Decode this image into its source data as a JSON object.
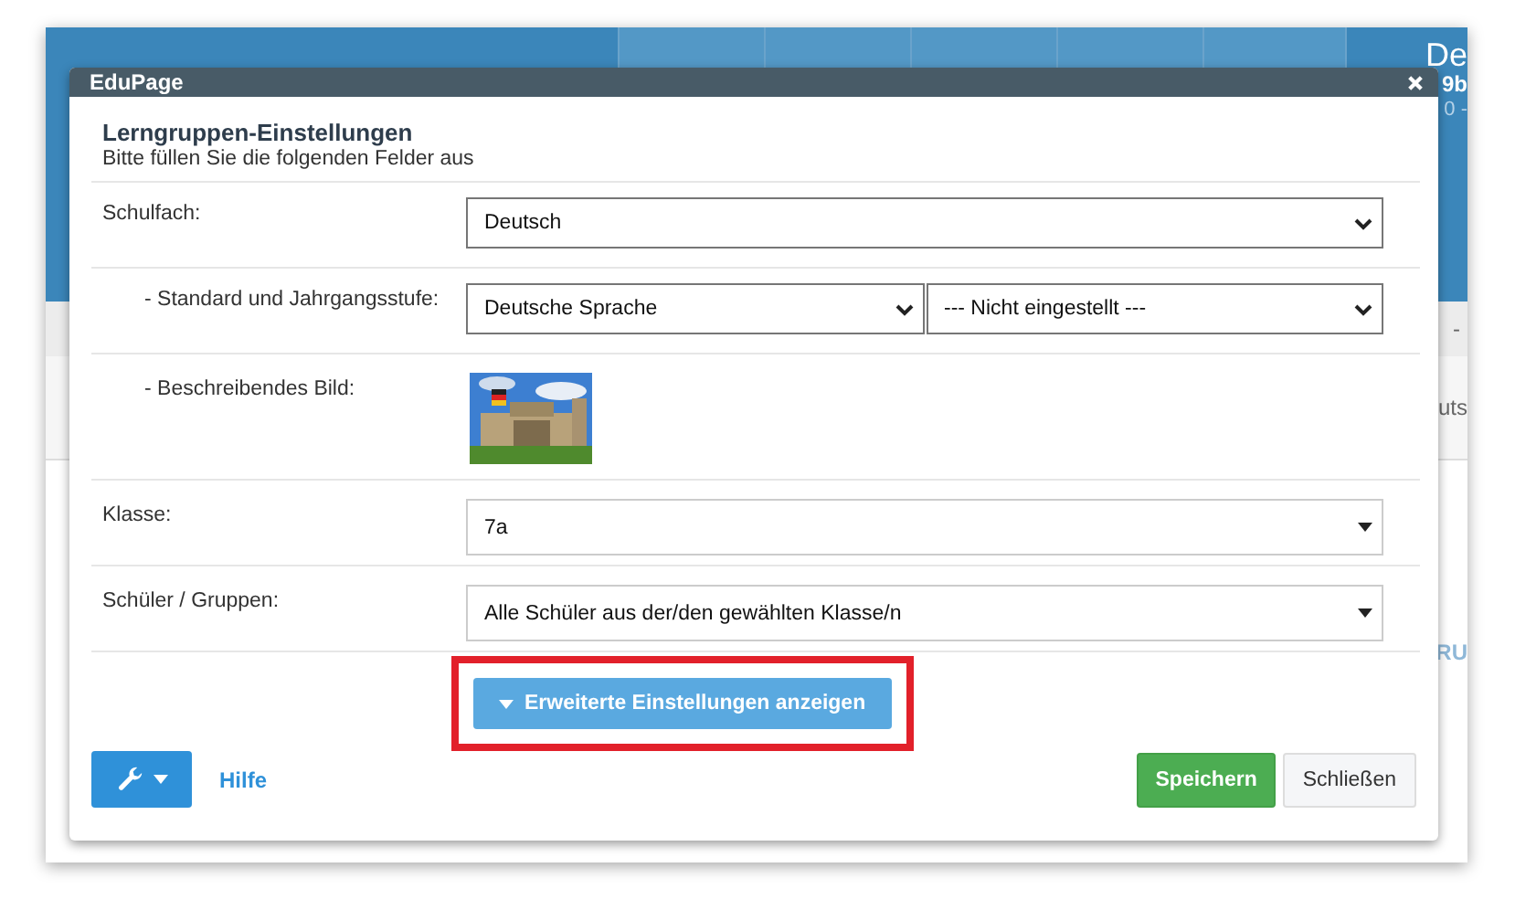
{
  "background": {
    "last_column": {
      "title": "De",
      "subtitle": "9b",
      "time": "0 -"
    },
    "dash": "-",
    "side_text": "uts",
    "link_text": "RU"
  },
  "dialog": {
    "app_name": "EduPage",
    "heading": "Lerngruppen-Einstellungen",
    "subheading": "Bitte füllen Sie die folgenden Felder aus",
    "fields": [
      {
        "kind": "select",
        "label": "Schulfach:",
        "indented": false,
        "values": [
          "Deutsch"
        ]
      },
      {
        "kind": "select",
        "label": "- Standard und Jahrgangsstufe:",
        "indented": true,
        "values": [
          "Deutsche Sprache",
          "--- Nicht eingestellt ---"
        ]
      },
      {
        "kind": "picture",
        "label": "- Beschreibendes Bild:",
        "indented": true
      },
      {
        "kind": "dropdown",
        "label": "Klasse:",
        "indented": false,
        "values": [
          "7a"
        ]
      },
      {
        "kind": "dropdown",
        "label": "Schüler / Gruppen:",
        "indented": false,
        "values": [
          "Alle Schüler aus der/den gewählten Klasse/n"
        ]
      }
    ],
    "toggle_button": {
      "label": "Erweiterte Einstellungen anzeigen",
      "highlighted": true
    },
    "help_link": "Hilfe",
    "save_button": "Speichern",
    "close_button": "Schließen"
  }
}
